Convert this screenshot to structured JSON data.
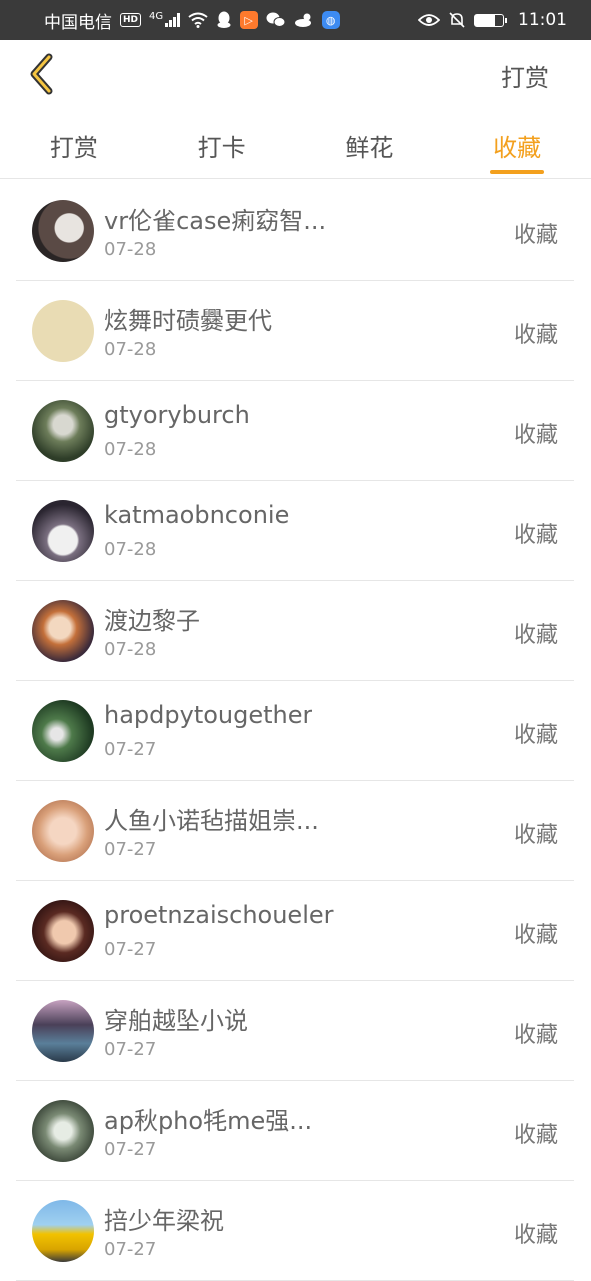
{
  "status_bar": {
    "carrier": "中国电信",
    "hd": "HD",
    "network": "4G",
    "time": "11:01",
    "icons": [
      "signal-icon",
      "wifi-icon",
      "qq-icon",
      "app-icon",
      "wechat-icon",
      "weather-icon",
      "browser-icon",
      "eye-icon",
      "mute-icon",
      "battery-icon"
    ]
  },
  "header": {
    "back_icon": "chevron-left-icon",
    "action_label": "打赏"
  },
  "tabs": [
    {
      "label": "打赏",
      "active": false
    },
    {
      "label": "打卡",
      "active": false
    },
    {
      "label": "鲜花",
      "active": false
    },
    {
      "label": "收藏",
      "active": true
    }
  ],
  "colors": {
    "accent": "#f3a01e",
    "status_bar_bg": "#3a3a3a",
    "text_primary": "#666666",
    "text_secondary": "#999999"
  },
  "items": [
    {
      "name": "vr伦雀case痢窈智...",
      "date": "07-28",
      "action": "收藏"
    },
    {
      "name": "炫舞时碛爨更代",
      "date": "07-28",
      "action": "收藏"
    },
    {
      "name": "gtyoryburch",
      "date": "07-28",
      "action": "收藏"
    },
    {
      "name": "katmaobnconie",
      "date": "07-28",
      "action": "收藏"
    },
    {
      "name": "渡边黎子",
      "date": "07-28",
      "action": "收藏"
    },
    {
      "name": "hapdpytougether",
      "date": "07-27",
      "action": "收藏"
    },
    {
      "name": "人鱼小诺毡描姐崇...",
      "date": "07-27",
      "action": "收藏"
    },
    {
      "name": "proetnzaischoueler",
      "date": "07-27",
      "action": "收藏"
    },
    {
      "name": "穿舶越坠小说",
      "date": "07-27",
      "action": "收藏"
    },
    {
      "name": "ap秋pho牦me强...",
      "date": "07-27",
      "action": "收藏"
    },
    {
      "name": "掊少年梁祝",
      "date": "07-27",
      "action": "收藏"
    }
  ]
}
